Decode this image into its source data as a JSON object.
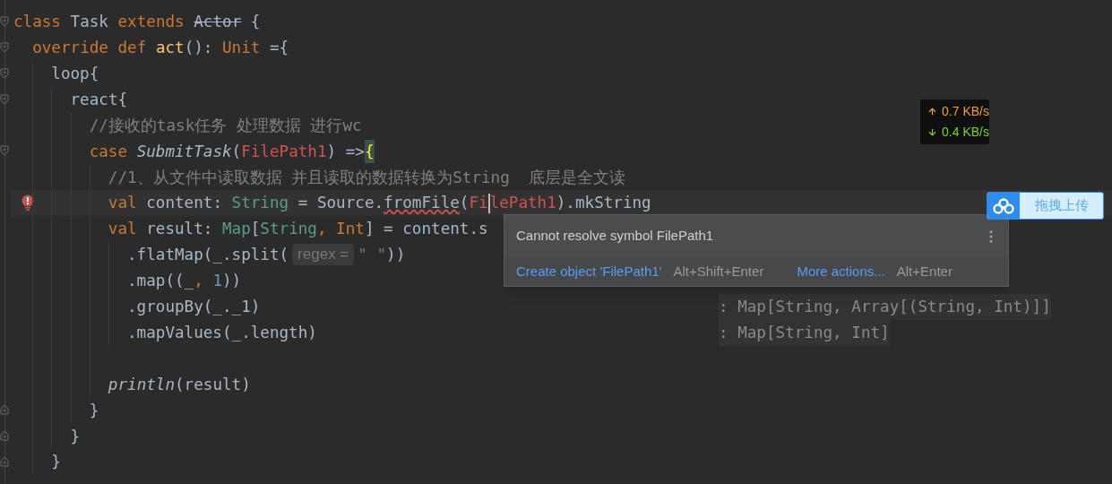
{
  "editor": {
    "lines": [
      {
        "fold_start": true,
        "fold_end": false,
        "current": false,
        "error": false,
        "tokens": [
          {
            "kind": "keyword",
            "text": "class "
          },
          {
            "kind": "plain",
            "text": "Task "
          },
          {
            "kind": "keyword",
            "text": "extends "
          },
          {
            "kind": "deprecated",
            "text": "Actor"
          },
          {
            "kind": "plain",
            "text": " {"
          }
        ],
        "children": [
          {
            "fold_start": true,
            "fold_end": false,
            "current": false,
            "error": false,
            "tokens": [
              {
                "kind": "keyword",
                "text": "override def "
              },
              {
                "kind": "function",
                "text": "act"
              },
              {
                "kind": "plain",
                "text": "(): "
              },
              {
                "kind": "keyword",
                "text": "Unit "
              },
              {
                "kind": "plain",
                "text": "={"
              }
            ],
            "children": [
              {
                "fold_start": true,
                "fold_end": false,
                "current": false,
                "error": false,
                "tokens": [
                  {
                    "kind": "plain",
                    "text": "loop{"
                  }
                ],
                "children": [
                  {
                    "fold_start": true,
                    "fold_end": false,
                    "current": false,
                    "error": false,
                    "tokens": [
                      {
                        "kind": "plain",
                        "text": "react{"
                      }
                    ],
                    "children": [
                      {
                        "fold_start": false,
                        "fold_end": false,
                        "current": false,
                        "error": false,
                        "tokens": [
                          {
                            "kind": "comment",
                            "text": "//接收的task任务 处理数据 进行wc"
                          }
                        ]
                      },
                      {
                        "fold_start": true,
                        "fold_end": false,
                        "current": false,
                        "error": false,
                        "tokens": [
                          {
                            "kind": "keyword",
                            "text": "case "
                          },
                          {
                            "kind": "italic",
                            "text": "SubmitTask"
                          },
                          {
                            "kind": "plain",
                            "text": "("
                          },
                          {
                            "kind": "error",
                            "text": "FilePath1"
                          },
                          {
                            "kind": "plain",
                            "text": ") =>"
                          },
                          {
                            "kind": "brace_match",
                            "text": "{"
                          }
                        ],
                        "children": [
                          {
                            "fold_start": false,
                            "fold_end": false,
                            "current": false,
                            "error": false,
                            "tokens": [
                              {
                                "kind": "comment",
                                "text": "//1、从文件中读取数据 并且读取的数据转换为String  底层是全文读"
                              }
                            ]
                          },
                          {
                            "fold_start": false,
                            "fold_end": false,
                            "current": true,
                            "error": true,
                            "tokens": [
                              {
                                "kind": "keyword",
                                "text": "val "
                              },
                              {
                                "kind": "plain",
                                "text": "content: "
                              },
                              {
                                "kind": "type",
                                "text": "String"
                              },
                              {
                                "kind": "plain",
                                "text": " = Source."
                              },
                              {
                                "kind": "warn",
                                "text": "fromFile"
                              },
                              {
                                "kind": "plain",
                                "text": "("
                              },
                              {
                                "kind": "error",
                                "text": "Fi"
                              },
                              {
                                "kind": "caret"
                              },
                              {
                                "kind": "error",
                                "text": "lePath1"
                              },
                              {
                                "kind": "plain",
                                "text": ").mkString"
                              }
                            ]
                          },
                          {
                            "fold_start": false,
                            "fold_end": false,
                            "current": false,
                            "error": false,
                            "tokens": [
                              {
                                "kind": "keyword",
                                "text": "val "
                              },
                              {
                                "kind": "plain",
                                "text": "result: "
                              },
                              {
                                "kind": "type",
                                "text": "Map"
                              },
                              {
                                "kind": "plain",
                                "text": "["
                              },
                              {
                                "kind": "type",
                                "text": "String"
                              },
                              {
                                "kind": "keyword",
                                "text": ", Int"
                              },
                              {
                                "kind": "plain",
                                "text": "] = content.s"
                              }
                            ],
                            "children": [
                              {
                                "fold_start": false,
                                "fold_end": false,
                                "current": false,
                                "error": false,
                                "tokens": [
                                  {
                                    "kind": "plain",
                                    "text": ".flatMap(_.split("
                                  },
                                  {
                                    "kind": "inlay",
                                    "text": "regex ="
                                  },
                                  {
                                    "kind": "string",
                                    "text": "\" \""
                                  },
                                  {
                                    "kind": "plain",
                                    "text": "))"
                                  }
                                ]
                              },
                              {
                                "fold_start": false,
                                "fold_end": false,
                                "current": false,
                                "error": false,
                                "tokens": [
                                  {
                                    "kind": "plain",
                                    "text": ".map((_"
                                  },
                                  {
                                    "kind": "keyword",
                                    "text": ", "
                                  },
                                  {
                                    "kind": "number",
                                    "text": "1"
                                  },
                                  {
                                    "kind": "plain",
                                    "text": "))"
                                  }
                                ]
                              },
                              {
                                "fold_start": false,
                                "fold_end": false,
                                "current": false,
                                "error": false,
                                "tokens": [
                                  {
                                    "kind": "plain",
                                    "text": ".groupBy(_._1)"
                                  }
                                ],
                                "type_hint": ": Map[String, Array[(String, Int)]]"
                              },
                              {
                                "fold_start": false,
                                "fold_end": false,
                                "current": false,
                                "error": false,
                                "tokens": [
                                  {
                                    "kind": "plain",
                                    "text": ".mapValues(_.length)"
                                  }
                                ],
                                "type_hint": ": Map[String, Int]"
                              }
                            ]
                          },
                          {
                            "fold_start": false,
                            "fold_end": false,
                            "current": false,
                            "error": false
                          },
                          {
                            "fold_start": false,
                            "fold_end": false,
                            "current": false,
                            "error": false,
                            "tokens": [
                              {
                                "kind": "italic",
                                "text": "println"
                              },
                              {
                                "kind": "plain",
                                "text": "(result)"
                              }
                            ]
                          }
                        ]
                      },
                      {
                        "fold_start": false,
                        "fold_end": true,
                        "current": false,
                        "error": false,
                        "tokens": [
                          {
                            "kind": "plain",
                            "text": "}"
                          }
                        ]
                      }
                    ]
                  },
                  {
                    "fold_start": false,
                    "fold_end": true,
                    "current": false,
                    "error": false,
                    "tokens": [
                      {
                        "kind": "plain",
                        "text": "}"
                      }
                    ]
                  }
                ]
              },
              {
                "fold_start": false,
                "fold_end": true,
                "current": false,
                "error": false,
                "tokens": [
                  {
                    "kind": "plain",
                    "text": "}"
                  }
                ]
              }
            ]
          }
        ]
      }
    ]
  },
  "error_popup": {
    "message": "Cannot resolve symbol FilePath1",
    "actions": [
      {
        "label": "Create object 'FilePath1'",
        "shortcut": "Alt+Shift+Enter"
      },
      {
        "label": "More actions...",
        "shortcut": "Alt+Enter"
      }
    ]
  },
  "net_speed": {
    "upload": "0.7 KB/s",
    "download": "0.4 KB/s"
  },
  "upload_button": {
    "label": "拖拽上传"
  }
}
